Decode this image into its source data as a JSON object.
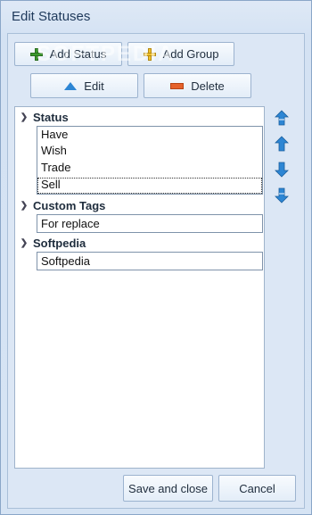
{
  "window": {
    "title": "Edit Statuses"
  },
  "toolbar": {
    "add_status": "Add Status",
    "add_group": "Add Group",
    "edit": "Edit",
    "delete": "Delete",
    "watermark": "SOFTPEDIA"
  },
  "groups": [
    {
      "label": "Status",
      "items": [
        "Have",
        "Wish",
        "Trade",
        "Sell"
      ]
    },
    {
      "label": "Custom Tags",
      "items": [
        "For replace"
      ]
    },
    {
      "label": "Softpedia",
      "items": [
        "Softpedia"
      ]
    }
  ],
  "footer": {
    "save_close": "Save and close",
    "cancel": "Cancel"
  },
  "icons": {
    "move_top": "double-up-arrow-icon",
    "move_up": "up-arrow-icon",
    "move_down": "down-arrow-icon",
    "move_bottom": "double-down-arrow-icon"
  },
  "colors": {
    "accent": "#2d86d4",
    "add": "#3c9a2e",
    "group": "#f0c12c",
    "delete": "#e5622b"
  }
}
